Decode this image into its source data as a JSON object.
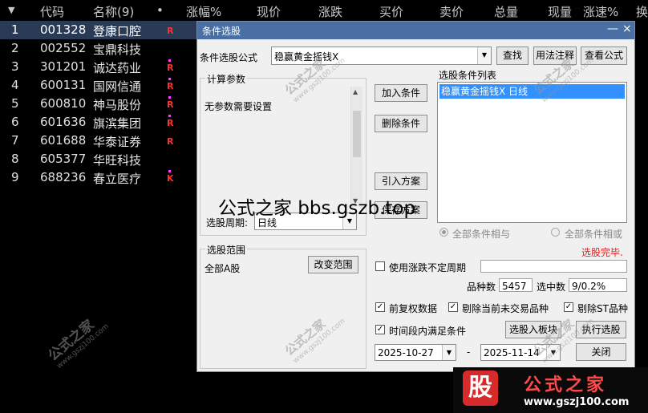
{
  "list_header": {
    "arrow": "▼",
    "code": "代码",
    "name": "名称(9)",
    "dot": "•",
    "change_pct": "涨幅%",
    "price": "现价",
    "change": "涨跌",
    "bid": "买价",
    "ask": "卖价",
    "volume": "总量",
    "cur_volume": "现量",
    "speed": "涨速%",
    "more": "换"
  },
  "stocks": [
    {
      "idx": "1",
      "code": "001328",
      "name": "登康口腔",
      "badge": "R"
    },
    {
      "idx": "2",
      "code": "002552",
      "name": "宝鼎科技",
      "badge": ""
    },
    {
      "idx": "3",
      "code": "301201",
      "name": "诚达药业",
      "badge": "R"
    },
    {
      "idx": "4",
      "code": "600131",
      "name": "国网信通",
      "badge": "R"
    },
    {
      "idx": "5",
      "code": "600810",
      "name": "神马股份",
      "badge": "R"
    },
    {
      "idx": "6",
      "code": "601636",
      "name": "旗滨集团",
      "badge": "R"
    },
    {
      "idx": "7",
      "code": "601688",
      "name": "华泰证券",
      "badge": "R"
    },
    {
      "idx": "8",
      "code": "605377",
      "name": "华旺科技",
      "badge": ""
    },
    {
      "idx": "9",
      "code": "688236",
      "name": "春立医疗",
      "badge": "K"
    }
  ],
  "dialog": {
    "title": "条件选股",
    "min": "—",
    "close": "×",
    "formula_label": "条件选股公式",
    "formula_value": "稳赢黄金摇钱X",
    "find_btn": "查找",
    "usage_btn": "用法注释",
    "view_btn": "查看公式",
    "params_group": "计算参数",
    "params_text": "无参数需要设置",
    "add_btn": "加入条件",
    "del_btn": "删除条件",
    "load_btn": "引入方案",
    "save_btn": "保存方案",
    "cond_list_label": "选股条件列表",
    "cond_item": "稳赢黄金摇钱X  日线",
    "period_label": "选股周期:",
    "period_value": "日线",
    "and_label": "全部条件相与",
    "or_label": "全部条件相或",
    "done_text": "选股完毕.",
    "range_group": "选股范围",
    "range_value": "全部A股",
    "change_range_btn": "改变范围",
    "use_period_label": "使用涨跌不定周期",
    "count_label": "品种数",
    "count_value": "5457",
    "selected_label": "选中数",
    "selected_value": "9/0.2%",
    "adj_label": "前复权数据",
    "no_trade_label": "剔除当前未交易品种",
    "no_st_label": "剔除ST品种",
    "time_label": "时间段内满足条件",
    "to_block_btn": "选股入板块",
    "run_btn": "执行选股",
    "date_from": "2025-10-27",
    "dash": "-",
    "date_to": "2025-11-14",
    "close_btn": "关闭"
  },
  "overlay_text": "公式之家 bbs.gszb.top",
  "watermark": {
    "cn": "公式之家",
    "url": "www.gszj100.com"
  },
  "logo": {
    "glyph": "股",
    "title": "公式之家",
    "url": "www.gszj100.com"
  }
}
